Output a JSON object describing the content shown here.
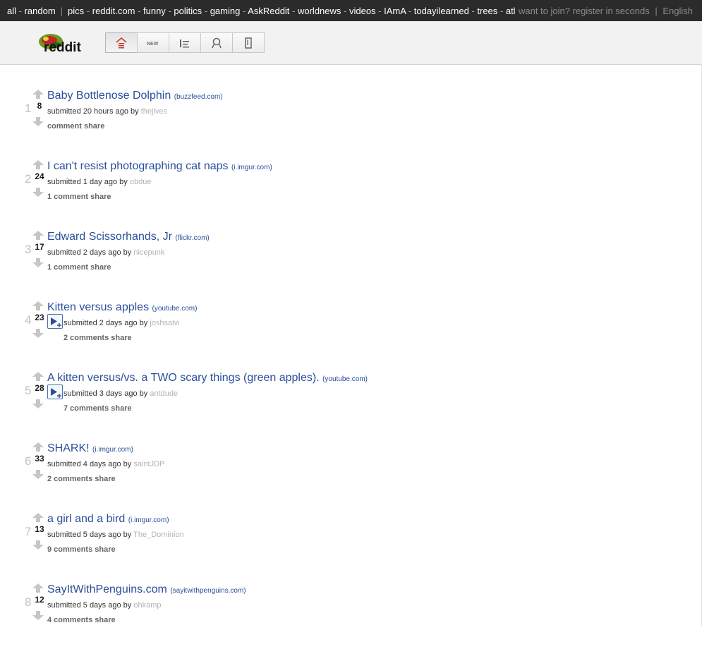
{
  "topbar": {
    "subreddits": [
      "all",
      "random",
      "pics",
      "reddit.com",
      "funny",
      "politics",
      "gaming",
      "AskReddit",
      "worldnews",
      "videos",
      "IAmA",
      "todayilearned",
      "trees",
      "atl"
    ],
    "want_to_join": "want to join?",
    "register": "register in seconds",
    "pipe": "|",
    "language": "English"
  },
  "header": {
    "logo_text": "reddit",
    "tabs": [
      "home-icon",
      "new-icon",
      "top-icon",
      "award-icon",
      "saved-icon"
    ],
    "new_label": "NEW"
  },
  "posts": [
    {
      "rank": "1",
      "score": "8",
      "title": "Baby Bottlenose Dolphin",
      "domain": "(buzzfeed.com)",
      "time": "20 hours ago",
      "author": "thejives",
      "comments": "comment",
      "share": "share",
      "expando": false
    },
    {
      "rank": "2",
      "score": "24",
      "title": "I can't resist photographing cat naps",
      "domain": "(i.imgur.com)",
      "time": "1 day ago",
      "author": "obdue",
      "comments": "1 comment",
      "share": "share",
      "expando": false
    },
    {
      "rank": "3",
      "score": "17",
      "title": "Edward Scissorhands, Jr",
      "domain": "(flickr.com)",
      "time": "2 days ago",
      "author": "nicepunk",
      "comments": "1 comment",
      "share": "share",
      "expando": false
    },
    {
      "rank": "4",
      "score": "23",
      "title": "Kitten versus apples",
      "domain": "(youtube.com)",
      "time": "2 days ago",
      "author": "joshsalvi",
      "comments": "2 comments",
      "share": "share",
      "expando": true
    },
    {
      "rank": "5",
      "score": "28",
      "title": "A kitten versus/vs. a TWO scary things (green apples).",
      "domain": "(youtube.com)",
      "time": "3 days ago",
      "author": "antdude",
      "comments": "7 comments",
      "share": "share",
      "expando": true
    },
    {
      "rank": "6",
      "score": "33",
      "title": "SHARK!",
      "domain": "(i.imgur.com)",
      "time": "4 days ago",
      "author": "saintJDP",
      "comments": "2 comments",
      "share": "share",
      "expando": false
    },
    {
      "rank": "7",
      "score": "13",
      "title": "a girl and a bird",
      "domain": "(i.imgur.com)",
      "time": "5 days ago",
      "author": "The_Dominion",
      "comments": "9 comments",
      "share": "share",
      "expando": false
    },
    {
      "rank": "8",
      "score": "12",
      "title": "SayItWithPenguins.com",
      "domain": "(sayitwithpenguins.com)",
      "time": "5 days ago",
      "author": "ohkamp",
      "comments": "4 comments",
      "share": "share",
      "expando": false
    }
  ],
  "labels": {
    "submitted": "submitted",
    "by": "by"
  }
}
